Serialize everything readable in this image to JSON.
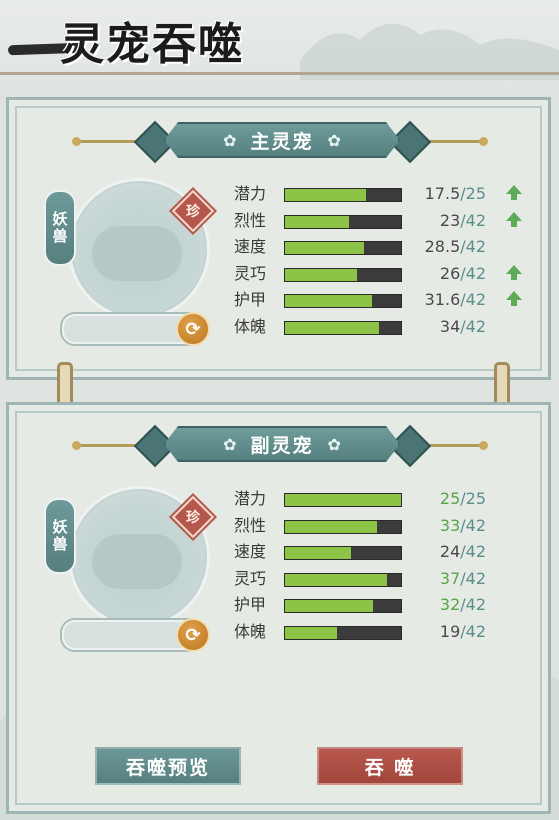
{
  "title": "灵宠吞噬",
  "main_pet": {
    "header": "主灵宠",
    "type_tag": "妖兽",
    "rarity": "珍",
    "swap_icon": "swap-icon",
    "stats": [
      {
        "label": "潜力",
        "current": "17.5",
        "max": "25",
        "fill": 0.7,
        "up": true,
        "green": false
      },
      {
        "label": "烈性",
        "current": "23",
        "max": "42",
        "fill": 0.55,
        "up": true,
        "green": false
      },
      {
        "label": "速度",
        "current": "28.5",
        "max": "42",
        "fill": 0.68,
        "up": false,
        "green": false
      },
      {
        "label": "灵巧",
        "current": "26",
        "max": "42",
        "fill": 0.62,
        "up": true,
        "green": false
      },
      {
        "label": "护甲",
        "current": "31.6",
        "max": "42",
        "fill": 0.75,
        "up": true,
        "green": false
      },
      {
        "label": "体魄",
        "current": "34",
        "max": "42",
        "fill": 0.81,
        "up": false,
        "green": false
      }
    ]
  },
  "sub_pet": {
    "header": "副灵宠",
    "type_tag": "妖兽",
    "rarity": "珍",
    "swap_icon": "swap-icon",
    "stats": [
      {
        "label": "潜力",
        "current": "25",
        "max": "25",
        "fill": 1.0,
        "green": true
      },
      {
        "label": "烈性",
        "current": "33",
        "max": "42",
        "fill": 0.79,
        "green": true
      },
      {
        "label": "速度",
        "current": "24",
        "max": "42",
        "fill": 0.57,
        "green": false
      },
      {
        "label": "灵巧",
        "current": "37",
        "max": "42",
        "fill": 0.88,
        "green": true
      },
      {
        "label": "护甲",
        "current": "32",
        "max": "42",
        "fill": 0.76,
        "green": true
      },
      {
        "label": "体魄",
        "current": "19",
        "max": "42",
        "fill": 0.45,
        "green": false
      }
    ]
  },
  "buttons": {
    "preview": "吞噬预览",
    "devour": "吞 噬"
  },
  "colors": {
    "bar_fill": "#8dc347",
    "bar_empty": "#3c3b3b",
    "accent_teal": "#5b8e8c",
    "devour_red": "#a1463c",
    "up_arrow": "#5dab57"
  }
}
